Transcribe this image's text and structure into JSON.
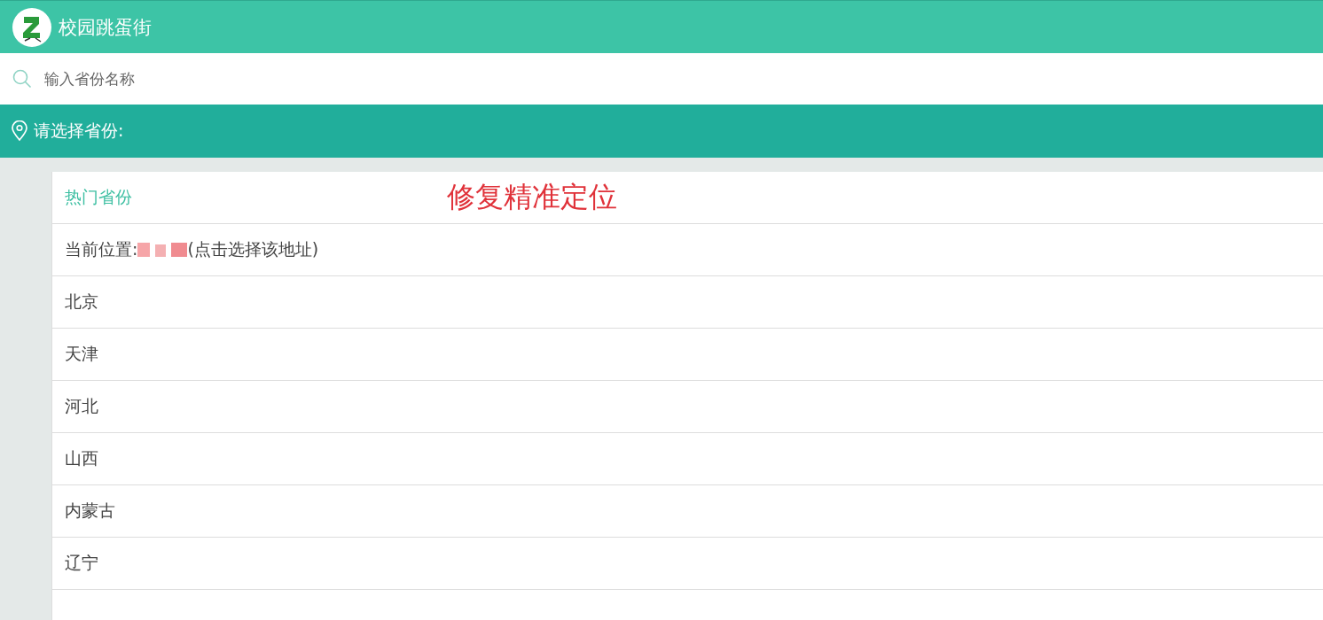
{
  "header": {
    "title": "校园跳蛋街"
  },
  "search": {
    "placeholder": "输入省份名称"
  },
  "section": {
    "title": "请选择省份:"
  },
  "list": {
    "heading": "热门省份",
    "annotation": "修复精准定位",
    "current_location": {
      "label": "当前位置:",
      "hint": "(点击选择该地址)"
    },
    "provinces": [
      "北京",
      "天津",
      "河北",
      "山西",
      "内蒙古",
      "辽宁"
    ]
  }
}
